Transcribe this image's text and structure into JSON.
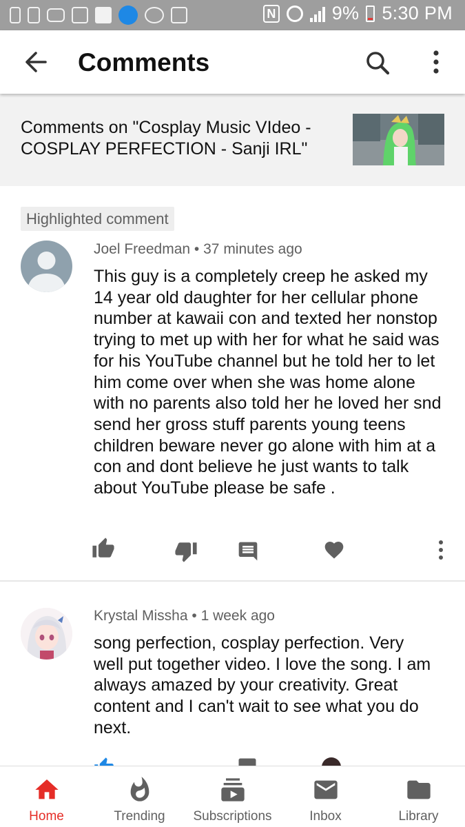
{
  "status_bar": {
    "battery": "9%",
    "time": "5:30 PM",
    "nfc": "N",
    "left_icons": [
      "alert-icon",
      "pin-icon",
      "youtube-icon",
      "shopping-bag-icon",
      "facebook-icon",
      "twitter-icon",
      "line-icon",
      "image-icon"
    ],
    "right_icons": [
      "nfc-icon",
      "alarm-icon",
      "signal-icon",
      "battery-icon"
    ]
  },
  "app_bar": {
    "title": "Comments",
    "back_icon": "arrow-back-icon",
    "search_icon": "search-icon",
    "more_icon": "more-vertical-icon"
  },
  "video": {
    "title": "Comments on \"Cosplay Music VIdeo - COSPLAY PERFECTION - Sanji IRL\""
  },
  "highlighted_label": "Highlighted comment",
  "comments": [
    {
      "author": "Joel Freedman",
      "time": "37 minutes ago",
      "separator": "•",
      "text": "This guy is a completely creep he asked my 14 year old daughter for her cellular phone number at kawaii con and texted her nonstop trying to met up with her for what he said was for his YouTube channel but he told her to let him come over when she was home alone with no parents also told her he loved her snd send her gross stuff parents young teens children beware never go alone with him at a con and dont believe he just wants to talk about YouTube please be safe ."
    },
    {
      "author": "Krystal Missha",
      "time": "1 week ago",
      "separator": "•",
      "text": "song perfection, cosplay perfection. Very well put together video.  I love the song. I am always amazed by your creativity. Great content and I can't wait to see what you do next."
    }
  ],
  "bottom_nav": [
    {
      "label": "Home",
      "icon": "home-icon",
      "active": true
    },
    {
      "label": "Trending",
      "icon": "flame-icon",
      "active": false
    },
    {
      "label": "Subscriptions",
      "icon": "subscriptions-icon",
      "active": false
    },
    {
      "label": "Inbox",
      "icon": "mail-icon",
      "active": false
    },
    {
      "label": "Library",
      "icon": "folder-icon",
      "active": false
    }
  ],
  "colors": {
    "accent_red": "#e52d27",
    "status_bar": "#9e9e9e",
    "header_bg": "#f2f2f2",
    "icon_gray": "#606060",
    "like_blue": "#1e88e5"
  }
}
